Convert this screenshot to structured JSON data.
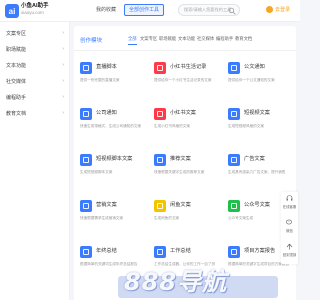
{
  "header": {
    "brand_name": "小鱼AI助手",
    "brand_sub": "xiaoyu.com",
    "nav_home": "我的收藏",
    "nav_tools": "全部创作工具",
    "search_placeholder": "搜索/请输入您要找的工具",
    "login_label": "去登录",
    "accent": "#3b7cff",
    "login_color": "#f5a623"
  },
  "sidebar": {
    "items": [
      {
        "label": "文案专区"
      },
      {
        "label": "职场赋能"
      },
      {
        "label": "文本功能"
      },
      {
        "label": "社交媒体"
      },
      {
        "label": "编程助手"
      },
      {
        "label": "教育文档"
      }
    ],
    "chevron": "›"
  },
  "main": {
    "section_title": "创作模块",
    "tabs": [
      {
        "label": "全部",
        "active": true
      },
      {
        "label": "文案专区",
        "active": false
      },
      {
        "label": "职场赋能",
        "active": false
      },
      {
        "label": "文本功能",
        "active": false
      },
      {
        "label": "社交媒体",
        "active": false
      },
      {
        "label": "编程助手",
        "active": false
      },
      {
        "label": "教育文档",
        "active": false
      }
    ],
    "tools": [
      {
        "title": "直播脚本",
        "desc": "提供一份完整的直播文案",
        "icon": "video-icon",
        "color": "#3b7cff"
      },
      {
        "title": "小红书生活记录",
        "desc": "提供给你一个小红书生活记录的文案",
        "icon": "book-red-icon",
        "color": "#ff3b4a"
      },
      {
        "title": "公文通知",
        "desc": "提供给你一个公文通知的文案",
        "icon": "doc-icon",
        "color": "#3b7cff"
      },
      {
        "title": "公司通知",
        "desc": "快速生成带格式、生成公司通知的文案",
        "icon": "megaphone-icon",
        "color": "#3b7cff"
      },
      {
        "title": "小红书文案",
        "desc": "生成小红书风格的文案",
        "icon": "book-red-icon",
        "color": "#ff3b4a"
      },
      {
        "title": "短视频文案",
        "desc": "生成短视频风格的文案",
        "icon": "video-icon",
        "color": "#3b7cff"
      },
      {
        "title": "短视频脚本文案",
        "desc": "生成短视频脚本文案",
        "icon": "film-icon",
        "color": "#3b7cff"
      },
      {
        "title": "推荐文案",
        "desc": "快速根据关键字生成的推荐文案",
        "icon": "thumb-icon",
        "color": "#3b7cff"
      },
      {
        "title": "广告文案",
        "desc": "生成具有感染力广告文案，提升销售",
        "icon": "ad-icon",
        "color": "#3b7cff"
      },
      {
        "title": "营销文案",
        "desc": "快速根据需求生成营销文案",
        "icon": "chart-icon",
        "color": "#3b7cff"
      },
      {
        "title": "闲鱼文案",
        "desc": "生成闲鱼的文案",
        "icon": "xianyu-icon",
        "color": "#f5c400"
      },
      {
        "title": "公众号文案",
        "desc": "公众号文案生成",
        "icon": "wechat-icon",
        "color": "#1fbf4c"
      },
      {
        "title": "年终总结",
        "desc": "根据简单的关键词生成年终总结报告",
        "icon": "summary-icon",
        "color": "#3b7cff"
      },
      {
        "title": "工作总结",
        "desc": "工作总结生成器，让你的工作一目了然",
        "icon": "work-icon",
        "color": "#3b7cff"
      },
      {
        "title": "项目方案报告",
        "desc": "根据简单的关键字生成项目的方案报告",
        "icon": "report-icon",
        "color": "#3b7cff"
      }
    ]
  },
  "float_tools": [
    {
      "label": "在线客服",
      "icon": "headset-icon"
    },
    {
      "label": "微信",
      "icon": "wechat-icon"
    },
    {
      "label": "回到顶部",
      "icon": "arrow-up-icon"
    }
  ],
  "watermark": "888导航"
}
